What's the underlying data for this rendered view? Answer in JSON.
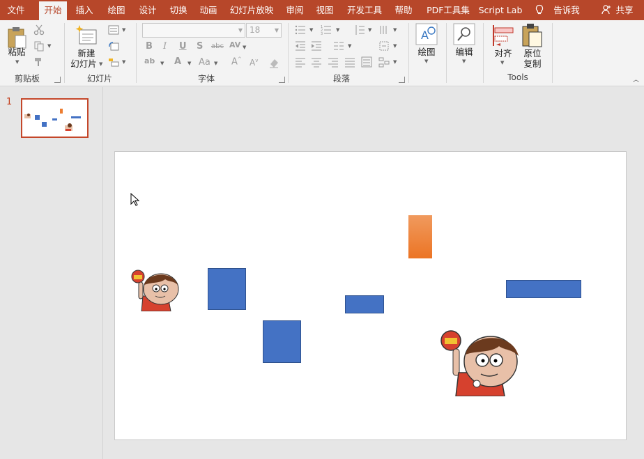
{
  "tabs": [
    {
      "label": "文件",
      "active": false
    },
    {
      "label": "开始",
      "active": true
    },
    {
      "label": "插入",
      "active": false
    },
    {
      "label": "绘图",
      "active": false
    },
    {
      "label": "设计",
      "active": false
    },
    {
      "label": "切换",
      "active": false
    },
    {
      "label": "动画",
      "active": false
    },
    {
      "label": "幻灯片放映",
      "active": false
    },
    {
      "label": "审阅",
      "active": false
    },
    {
      "label": "视图",
      "active": false
    },
    {
      "label": "开发工具",
      "active": false
    },
    {
      "label": "帮助",
      "active": false
    },
    {
      "label": "PDF工具集",
      "active": false
    },
    {
      "label": "Script Lab",
      "active": false
    }
  ],
  "tell_me": {
    "label": "告诉我",
    "icon": "lightbulb-icon"
  },
  "share": {
    "label": "共享",
    "icon": "person-add-icon"
  },
  "groups": {
    "clipboard": {
      "label": "剪贴板",
      "paste_label": "粘贴"
    },
    "slides": {
      "label": "幻灯片",
      "new_slide_label_line1": "新建",
      "new_slide_label_line2": "幻灯片"
    },
    "font": {
      "label": "字体",
      "font_name_value": "",
      "font_size_value": "18"
    },
    "paragraph": {
      "label": "段落"
    },
    "drawing": {
      "draw_label": "绘图"
    },
    "editing": {
      "edit_label": "编辑"
    },
    "tools": {
      "label": "Tools",
      "align_label": "对齐",
      "paste_in_place_line1": "原位",
      "paste_in_place_line2": "复制"
    }
  },
  "thumbnails": [
    {
      "number": "1"
    }
  ],
  "colors": {
    "accent": "#b7472a",
    "shape_blue": "#4472c4",
    "shape_orange": "#ed7d31"
  }
}
